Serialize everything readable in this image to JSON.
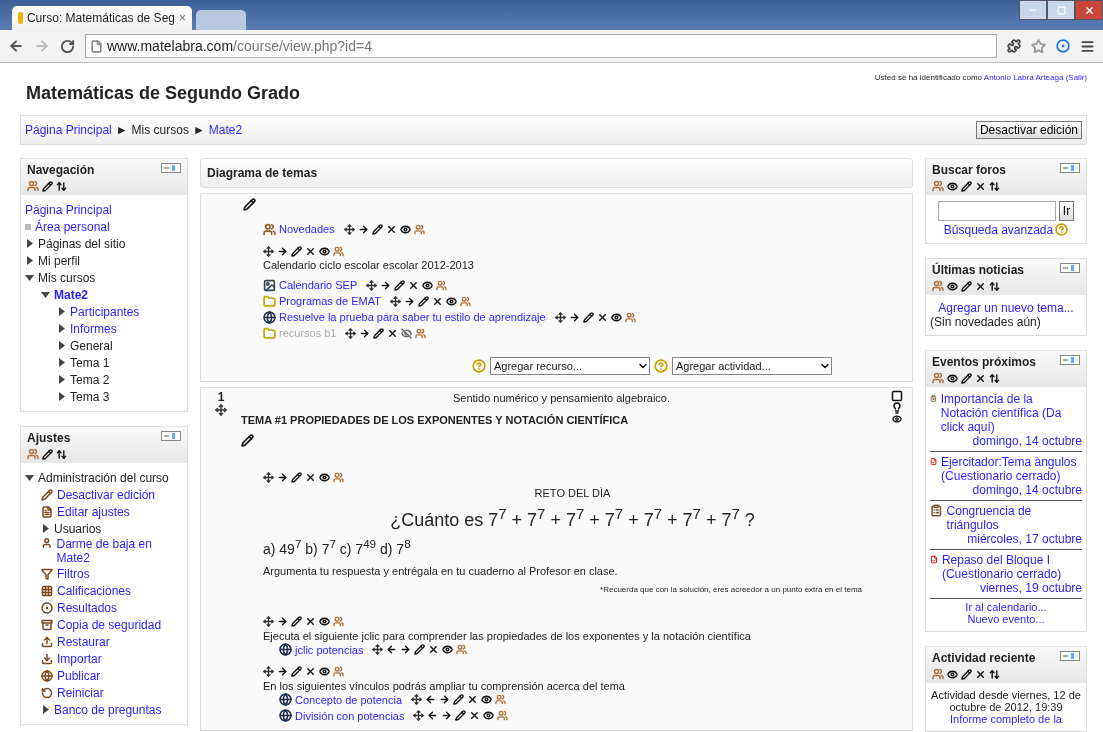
{
  "browser": {
    "tab_title": "Curso: Matemáticas de Seg",
    "tab_close": "×",
    "url_host": "www.matelabra.com",
    "url_path": "/course/view.php?id=4"
  },
  "header": {
    "title": "Matemáticas de Segundo Grado",
    "login_text": "Usted se ha identificado como",
    "user": "Antonio Labra Arteaga",
    "logout": "(Salir)"
  },
  "breadcrumb": {
    "separator": "►",
    "items": [
      {
        "label": "Página Principal",
        "link": true
      },
      {
        "label": "Mis cursos",
        "link": false
      },
      {
        "label": "Mate2",
        "link": true
      }
    ]
  },
  "edit_button": "Desactivar edición",
  "navigation": {
    "title": "Navegación",
    "items": [
      {
        "label": "Página Principal",
        "kind": "plain",
        "link": true,
        "current": false
      },
      {
        "label": "Área personal",
        "kind": "bullet",
        "link": true,
        "current": false
      },
      {
        "label": "Páginas del sitio",
        "kind": "branch",
        "expanded": false,
        "link": false,
        "current": false
      },
      {
        "label": "Mi perfil",
        "kind": "branch",
        "expanded": false,
        "link": false,
        "current": false
      },
      {
        "label": "Mis cursos",
        "kind": "branch",
        "expanded": true,
        "link": false,
        "current": false,
        "children": [
          {
            "label": "Mate2",
            "kind": "branch",
            "expanded": true,
            "link": true,
            "current": true,
            "children": [
              {
                "label": "Participantes",
                "kind": "branch",
                "expanded": false,
                "link": true,
                "current": false
              },
              {
                "label": "Informes",
                "kind": "branch",
                "expanded": false,
                "link": true,
                "current": false
              },
              {
                "label": "General",
                "kind": "branch",
                "expanded": false,
                "link": false,
                "current": false
              },
              {
                "label": "Tema 1",
                "kind": "branch",
                "expanded": false,
                "link": false,
                "current": false
              },
              {
                "label": "Tema 2",
                "kind": "branch",
                "expanded": false,
                "link": false,
                "current": false
              },
              {
                "label": "Tema 3",
                "kind": "branch",
                "expanded": false,
                "link": false,
                "current": false
              }
            ]
          }
        ]
      }
    ]
  },
  "settings": {
    "title": "Ajustes",
    "items": [
      {
        "label": "Administración del curso",
        "kind": "branch",
        "expanded": true,
        "link": false,
        "current": false,
        "children": [
          {
            "label": "Desactivar edición",
            "kind": "icon",
            "link": true,
            "current": false
          },
          {
            "label": "Editar ajustes",
            "kind": "icon",
            "link": true,
            "current": false
          },
          {
            "label": "Usuarios",
            "kind": "branch",
            "expanded": false,
            "link": false,
            "current": false
          },
          {
            "label": "Darme de baja en Mate2",
            "kind": "icon",
            "link": true,
            "current": false
          },
          {
            "label": "Filtros",
            "kind": "icon",
            "link": true,
            "current": false
          },
          {
            "label": "Calificaciones",
            "kind": "icon",
            "link": true,
            "current": false
          },
          {
            "label": "Resultados",
            "kind": "icon",
            "link": true,
            "current": false
          },
          {
            "label": "Copia de seguridad",
            "kind": "icon",
            "link": true,
            "current": false
          },
          {
            "label": "Restaurar",
            "kind": "icon",
            "link": true,
            "current": false
          },
          {
            "label": "Importar",
            "kind": "icon",
            "link": true,
            "current": false
          },
          {
            "label": "Publicar",
            "kind": "icon",
            "link": true,
            "current": false
          },
          {
            "label": "Reiniciar",
            "kind": "icon",
            "link": true,
            "current": false
          },
          {
            "label": "Banco de preguntas",
            "kind": "branch",
            "expanded": false,
            "link": true,
            "current": false
          }
        ]
      }
    ]
  },
  "main": {
    "title": "Diagrama de temas",
    "section0": {
      "modules": [
        {
          "kind": "forum",
          "title": "Novedades",
          "indented": false,
          "hidden": false
        },
        {
          "kind": "label",
          "indented": false,
          "hidden": false,
          "lines": [
            {
              "kind": "text",
              "text": "Calendario ciclo escolar escolar  2012-2013"
            }
          ]
        },
        {
          "kind": "image",
          "title": "Calendario SEP",
          "indented": false,
          "hidden": false
        },
        {
          "kind": "folder",
          "title": "Programas de EMAT",
          "indented": false,
          "hidden": false
        },
        {
          "kind": "url",
          "title": "Resuelve la prueba para saber tu estilo de aprendizaje",
          "indented": false,
          "hidden": false
        },
        {
          "kind": "folder",
          "title": "recursos b1",
          "indented": false,
          "hidden": true
        }
      ],
      "add_resource": "Agregar recurso...",
      "add_activity": "Agregar actividad..."
    },
    "section1": {
      "number": "1",
      "summary": "Sentido numérico y pensamiento algebraico.",
      "title": "TEMA #1 PROPIEDADES DE LOS EXPONENTES Y NOTACIÓN CIENTÍFICA",
      "modules": [
        {
          "kind": "label",
          "indented": false,
          "hidden": false,
          "lines": [
            {
              "kind": "center",
              "text": "RETO DEL DÌA"
            },
            {
              "kind": "question",
              "text": "¿Cuánto es 7$^{7}$ + 7$^{7}$ + 7$^{7}$ + 7$^{7}$ + 7$^{7}$ + 7$^{7}$ + 7$^{7}$ ?"
            },
            {
              "kind": "answers",
              "text": "a) 49$^{7}$   b) 7$^{7}$   c) 7$^{49}$  d) 7$^{8}$"
            },
            {
              "kind": "text",
              "text": "Argumenta tu respuesta y entrégala en tu cuaderno al Profesor en clase."
            },
            {
              "kind": "note",
              "text": "*Recuerda que con la solución, eres acreedor a un punto extra en el tema"
            }
          ]
        },
        {
          "kind": "label",
          "indented": false,
          "hidden": false,
          "lines": [
            {
              "kind": "text",
              "text": "Ejecuta el siguiente jclic para comprender las propiedades de los exponentes y la notación científica"
            }
          ]
        },
        {
          "kind": "url",
          "title": "jclic potencias",
          "indented": true,
          "hidden": false
        },
        {
          "kind": "label",
          "indented": false,
          "hidden": false,
          "lines": [
            {
              "kind": "text",
              "text": "En los siguientes vínculos podrás ampliar tu comprensión acerca del tema"
            }
          ]
        },
        {
          "kind": "url",
          "title": "Concepto de potencia",
          "indented": true,
          "hidden": false
        },
        {
          "kind": "url",
          "title": "División con potencias",
          "indented": true,
          "hidden": false
        }
      ]
    }
  },
  "search_forums": {
    "title": "Buscar foros",
    "button": "Ir",
    "advanced": "Búsqueda avanzada"
  },
  "news": {
    "title": "Últimas noticias",
    "add": "Agregar un nuevo tema...",
    "empty": "(Sin novedades aún)"
  },
  "events": {
    "title": "Eventos próximos",
    "items": [
      {
        "kind": "assignment",
        "title": "Importancia de la Notación científica (Da click aquí)",
        "date": "domingo, 14 octubre"
      },
      {
        "kind": "quiz",
        "title": "Ejercitador:Tema àngulos (Cuestionario cerrado)",
        "date": "domingo, 14 octubre"
      },
      {
        "kind": "assignment",
        "title": "Congruencia de triángulos",
        "date": "miércoles, 17 octubre"
      },
      {
        "kind": "quiz",
        "title": "Repaso del Bloque I (Cuestionario cerrado)",
        "date": "viernes, 19 octubre"
      }
    ],
    "calendar_link": "Ir al calendario...",
    "new_event": "Nuevo evento..."
  },
  "recent": {
    "title": "Actividad reciente",
    "since": "Actividad desde viernes, 12 de octubre de 2012, 19:39",
    "report": "Informe completo de la"
  }
}
